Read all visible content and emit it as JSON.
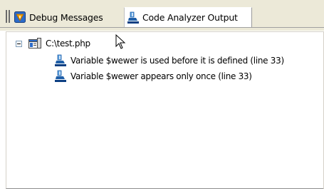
{
  "tabs": {
    "debug_label": "Debug Messages",
    "code_label": "Code Analyzer Output"
  },
  "tree": {
    "file_label": "C:\\test.php",
    "items": [
      {
        "text": "Variable $wewer is used before it is defined (line 33)"
      },
      {
        "text": "Variable $wewer appears only once (line 33)"
      }
    ]
  },
  "icons": {
    "debug_tab_icon": "debug-icon",
    "code_tab_icon": "code-analyzer-icon",
    "file_icon": "php-file-icon",
    "item_icon": "code-analyzer-icon",
    "expander": "collapse-icon",
    "cursor": "mouse-pointer-icon"
  },
  "colors": {
    "tabbar_bg": "#ece9d8",
    "active_tab_bg": "#ffffff",
    "debug_icon_accent": "#f0a000",
    "analyzer_icon_accent": "#1f5fa8"
  }
}
